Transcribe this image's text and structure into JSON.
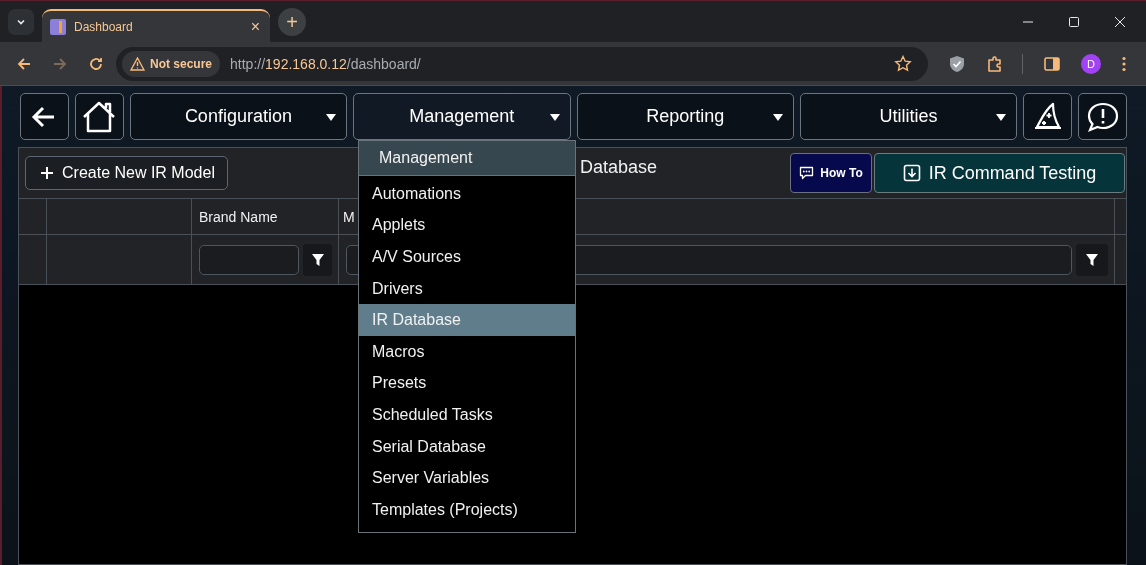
{
  "browser": {
    "tab": {
      "title": "Dashboard",
      "close": "×"
    },
    "new_tab": "+",
    "security": "Not secure",
    "url": {
      "scheme": "http://",
      "host": "192.168.0.12",
      "path": "/dashboard/"
    },
    "profile": "D"
  },
  "nav": {
    "menus": [
      {
        "label": "Configuration",
        "open": false
      },
      {
        "label": "Management",
        "open": true
      },
      {
        "label": "Reporting",
        "open": false
      },
      {
        "label": "Utilities",
        "open": false
      }
    ]
  },
  "toolbar": {
    "create_button": "Create New IR Model",
    "title": "Database",
    "how_to_button": "How To",
    "testing_button": "IR Command Testing"
  },
  "table": {
    "columns": [
      "Brand Name",
      "M"
    ]
  },
  "dropdown": {
    "header": "Management",
    "items": [
      {
        "label": "Automations",
        "selected": false
      },
      {
        "label": "Applets",
        "selected": false
      },
      {
        "label": "A/V Sources",
        "selected": false
      },
      {
        "label": "Drivers",
        "selected": false
      },
      {
        "label": "IR Database",
        "selected": true
      },
      {
        "label": "Macros",
        "selected": false
      },
      {
        "label": "Presets",
        "selected": false
      },
      {
        "label": "Scheduled Tasks",
        "selected": false
      },
      {
        "label": "Serial Database",
        "selected": false
      },
      {
        "label": "Server Variables",
        "selected": false
      },
      {
        "label": "Templates (Projects)",
        "selected": false
      }
    ]
  }
}
